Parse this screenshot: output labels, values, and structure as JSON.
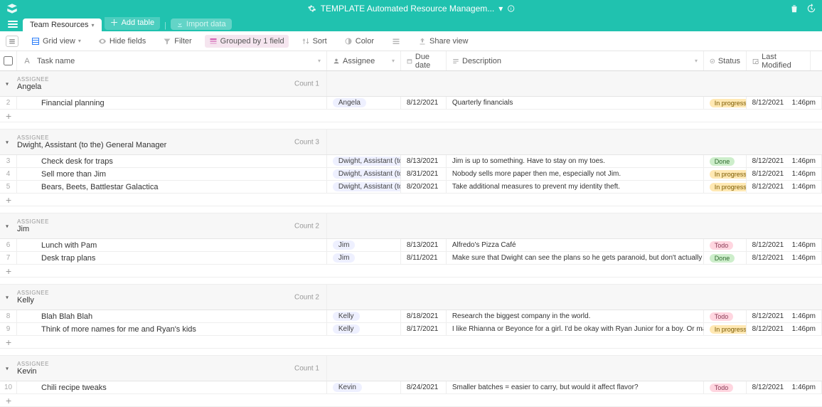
{
  "colors": {
    "brand": "#20c2af"
  },
  "topbar": {
    "title": "TEMPLATE Automated Resource Managem...",
    "title_chev": "▾"
  },
  "tabs": {
    "active": "Team Resources",
    "add_table": "Add table",
    "import_data": "Import data"
  },
  "toolbar": {
    "view_name": "Grid view",
    "hide_fields": "Hide fields",
    "filter": "Filter",
    "grouped": "Grouped by 1 field",
    "sort": "Sort",
    "color": "Color",
    "share": "Share view"
  },
  "columns": {
    "task": "Task name",
    "assignee": "Assignee",
    "due": "Due date",
    "desc": "Description",
    "status": "Status",
    "lastmod": "Last Modified"
  },
  "group_label": "ASSIGNEE",
  "count_label": "Count",
  "groups": [
    {
      "name": "Angela",
      "count": "1",
      "rows": [
        {
          "n": "2",
          "task": "Financial planning",
          "assignee": "Angela",
          "due": "8/12/2021",
          "desc": "Quarterly financials",
          "status": "In progress",
          "status_class": "status-inprogress",
          "lm_date": "8/12/2021",
          "lm_time": "1:46pm"
        }
      ]
    },
    {
      "name": "Dwight, Assistant (to the) General Manager",
      "count": "3",
      "rows": [
        {
          "n": "3",
          "task": "Check desk for traps",
          "assignee": "Dwight, Assistant (to th...",
          "due": "8/13/2021",
          "desc": "Jim is up to something. Have to stay on my toes.",
          "status": "Done",
          "status_class": "status-done",
          "lm_date": "8/12/2021",
          "lm_time": "1:46pm"
        },
        {
          "n": "4",
          "task": "Sell more than Jim",
          "assignee": "Dwight, Assistant (to th...",
          "due": "8/31/2021",
          "desc": "Nobody sells more paper then me, especially not Jim.",
          "status": "In progress",
          "status_class": "status-inprogress",
          "lm_date": "8/12/2021",
          "lm_time": "1:46pm"
        },
        {
          "n": "5",
          "task": "Bears, Beets, Battlestar Galactica",
          "assignee": "Dwight, Assistant (to th...",
          "due": "8/20/2021",
          "desc": "Take additional measures to prevent my identity theft.",
          "status": "In progress",
          "status_class": "status-inprogress",
          "lm_date": "8/12/2021",
          "lm_time": "1:46pm"
        }
      ]
    },
    {
      "name": "Jim",
      "count": "2",
      "rows": [
        {
          "n": "6",
          "task": "Lunch with Pam",
          "assignee": "Jim",
          "due": "8/13/2021",
          "desc": "Alfredo's Pizza Café",
          "status": "Todo",
          "status_class": "status-todo",
          "lm_date": "8/12/2021",
          "lm_time": "1:46pm"
        },
        {
          "n": "7",
          "task": "Desk trap plans",
          "assignee": "Jim",
          "due": "8/11/2021",
          "desc": "Make sure that Dwight can see the plans so he gets paranoid, but don't actually set any traps.",
          "status": "Done",
          "status_class": "status-done",
          "lm_date": "8/12/2021",
          "lm_time": "1:46pm"
        }
      ]
    },
    {
      "name": "Kelly",
      "count": "2",
      "rows": [
        {
          "n": "8",
          "task": "Blah Blah Blah",
          "assignee": "Kelly",
          "due": "8/18/2021",
          "desc": "Research the biggest company in the world.",
          "status": "Todo",
          "status_class": "status-todo",
          "lm_date": "8/12/2021",
          "lm_time": "1:46pm"
        },
        {
          "n": "9",
          "task": "Think of more names for me and Ryan's kids",
          "assignee": "Kelly",
          "due": "8/17/2021",
          "desc": "I like Rhianna or Beyonce for a girl. I'd be okay with Ryan Junior for a boy. Or maybe like Fabio.",
          "status": "In progress",
          "status_class": "status-inprogress",
          "lm_date": "8/12/2021",
          "lm_time": "1:46pm"
        }
      ]
    },
    {
      "name": "Kevin",
      "count": "1",
      "rows": [
        {
          "n": "10",
          "task": "Chili recipe tweaks",
          "assignee": "Kevin",
          "due": "8/24/2021",
          "desc": "Smaller batches = easier to carry, but would it affect flavor?",
          "status": "Todo",
          "status_class": "status-todo",
          "lm_date": "8/12/2021",
          "lm_time": "1:46pm"
        }
      ]
    }
  ]
}
